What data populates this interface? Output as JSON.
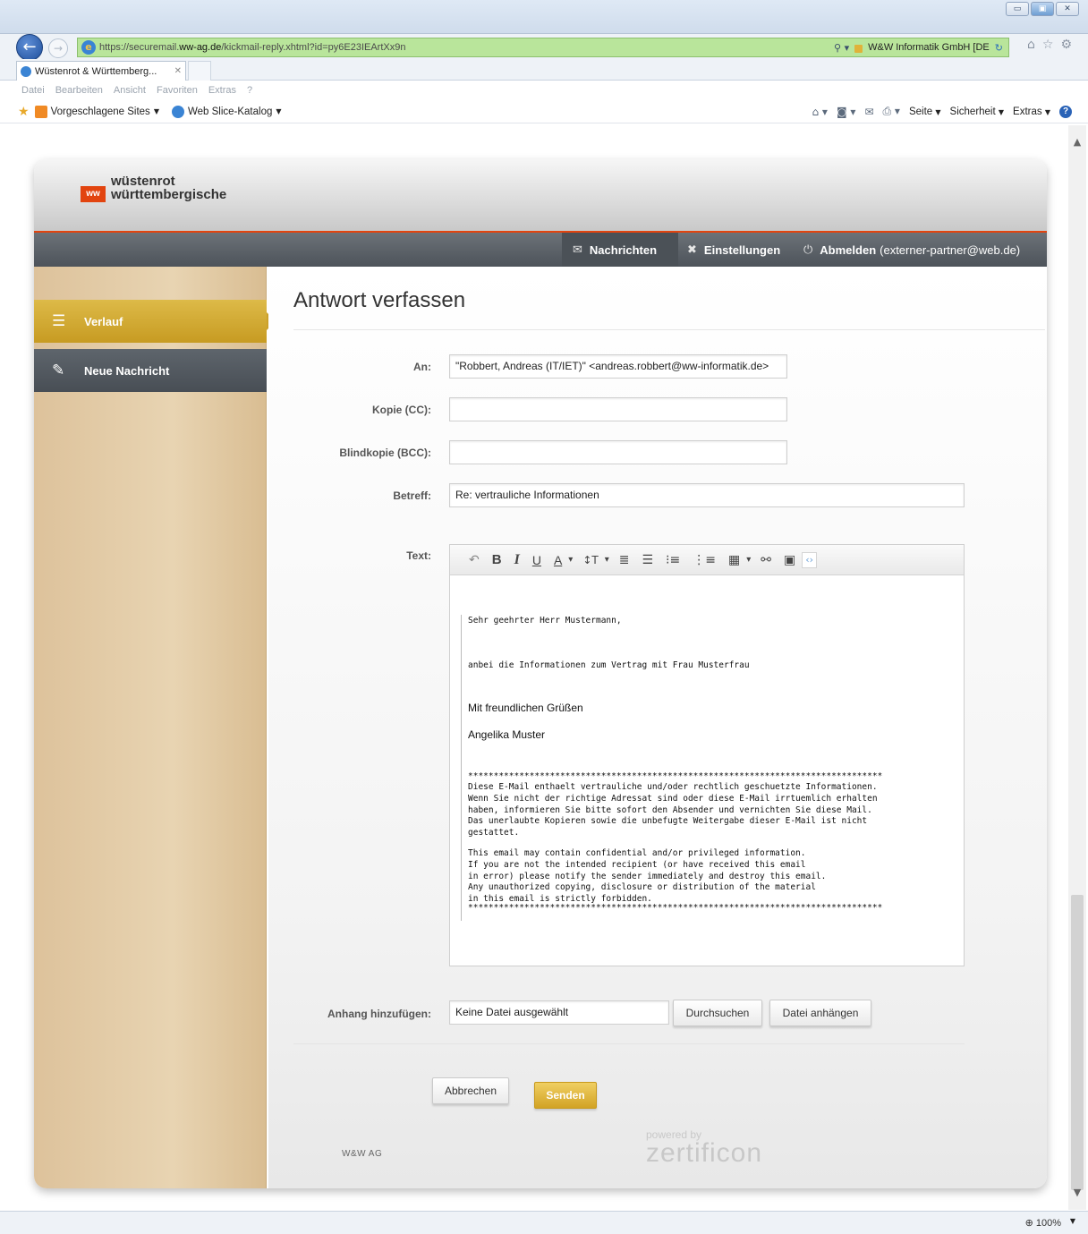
{
  "browser": {
    "url_prefix": "https://securemail.",
    "url_domain": "ww-ag.de",
    "url_path": "/kickmail-reply.xhtml?id=py6E23IEArtXx9n",
    "site_identity": "W&W Informatik GmbH [DE",
    "tab_title": "Wüstenrot & Württemberg...",
    "menu": [
      "Datei",
      "Bearbeiten",
      "Ansicht",
      "Favoriten",
      "Extras",
      "?"
    ],
    "favorites": [
      {
        "label": "Vorgeschlagene Sites"
      },
      {
        "label": "Web Slice-Katalog"
      }
    ],
    "commands": {
      "seite": "Seite",
      "sicherheit": "Sicherheit",
      "extras": "Extras"
    },
    "zoom": "100%"
  },
  "brand": {
    "logo_badge": "ww",
    "line1": "wüstenrot",
    "line2": "württembergische",
    "accent": "#e2440f"
  },
  "topnav": {
    "messages": "Nachrichten",
    "settings": "Einstellungen",
    "logout": "Abmelden",
    "user": "(externer-partner@web.de)"
  },
  "sidebar": {
    "items": [
      {
        "label": "Verlauf",
        "icon": "list-icon"
      },
      {
        "label": "Neue Nachricht",
        "icon": "compose-icon"
      }
    ]
  },
  "form": {
    "title": "Antwort verfassen",
    "to_label": "An:",
    "to_value": "\"Robbert, Andreas (IT/IET)\" <andreas.robbert@ww-informatik.de>",
    "cc_label": "Kopie (CC):",
    "cc_value": "",
    "bcc_label": "Blindkopie (BCC):",
    "bcc_value": "",
    "subject_label": "Betreff:",
    "subject_value": "Re: vertrauliche Informationen",
    "text_label": "Text:",
    "attach_label": "Anhang hinzufügen:",
    "attach_value": "Keine Datei ausgewählt",
    "browse_button": "Durchsuchen",
    "attach_button": "Datei anhängen",
    "cancel_button": "Abbrechen",
    "send_button": "Senden"
  },
  "editor": {
    "toolbar": {
      "bold": "B",
      "italic": "I",
      "underline": "U",
      "color": "A",
      "size": "↕T"
    },
    "greeting": "Sehr geehrter Herr Mustermann,",
    "body": "anbei die Informationen zum Vertrag mit Frau Musterfrau",
    "closing": "Mit freundlichen Grüßen",
    "signature": "Angelika Muster",
    "stars": "*********************************************************************************",
    "disclaimer_de": [
      "Diese E-Mail enthaelt vertrauliche und/oder rechtlich geschuetzte Informationen.",
      "Wenn Sie nicht der richtige Adressat sind oder diese E-Mail irrtuemlich erhalten",
      "haben, informieren Sie bitte sofort den Absender und vernichten Sie diese Mail.",
      "Das unerlaubte Kopieren sowie die unbefugte Weitergabe dieser E-Mail ist nicht",
      "gestattet."
    ],
    "disclaimer_en": [
      "This email may contain confidential and/or privileged information.",
      "If you are not the intended recipient (or have received this email",
      "in error) please notify the sender immediately and destroy this email.",
      "Any unauthorized copying, disclosure or distribution of the material",
      "in this email is strictly forbidden."
    ]
  },
  "footer": {
    "company": "W&W AG",
    "powered_by": "powered by",
    "vendor": "zertificon"
  }
}
